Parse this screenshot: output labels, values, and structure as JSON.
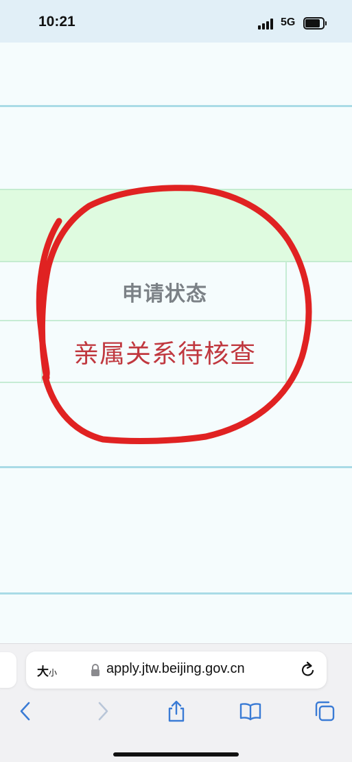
{
  "status_bar": {
    "time": "10:21",
    "network": "5G",
    "battery_level": 0.85
  },
  "table": {
    "header_label": "申请状态",
    "status_value": "亲属关系待核查"
  },
  "annotation": {
    "color": "#e02222"
  },
  "browser": {
    "text_size_big": "大",
    "text_size_small": "小",
    "url": "apply.jtw.beijing.gov.cn",
    "icons": {
      "lock": "lock-icon",
      "reload": "reload-icon",
      "back": "chevron-left-icon",
      "forward": "chevron-right-icon",
      "share": "share-icon",
      "bookmarks": "book-icon",
      "tabs": "tabs-icon"
    },
    "accent": "#3a7bd5"
  }
}
